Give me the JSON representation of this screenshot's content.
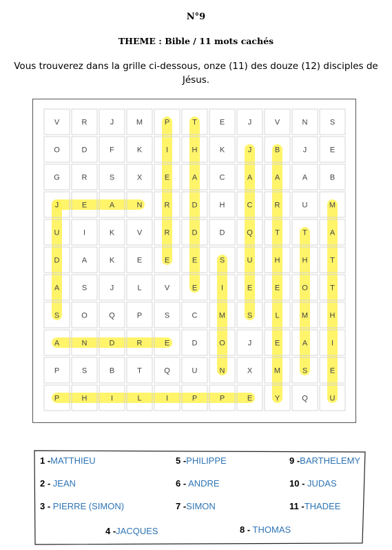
{
  "header": {
    "number": "N°9",
    "theme": "THEME : Bible / 11 mots cachés",
    "intro": "Vous trouverez dans la grille ci-dessous, onze (11) des douze (12) disciples de Jésus."
  },
  "grid": {
    "rows": [
      [
        "V",
        "R",
        "J",
        "M",
        "P",
        "T",
        "E",
        "J",
        "V",
        "N",
        "S"
      ],
      [
        "O",
        "D",
        "F",
        "K",
        "I",
        "H",
        "K",
        "J",
        "B",
        "J",
        "E"
      ],
      [
        "G",
        "R",
        "S",
        "X",
        "E",
        "A",
        "C",
        "A",
        "A",
        "A",
        "B"
      ],
      [
        "J",
        "E",
        "A",
        "N",
        "R",
        "D",
        "H",
        "C",
        "R",
        "U",
        "M"
      ],
      [
        "U",
        "I",
        "K",
        "V",
        "R",
        "D",
        "D",
        "Q",
        "T",
        "T",
        "A"
      ],
      [
        "D",
        "A",
        "K",
        "E",
        "E",
        "E",
        "S",
        "U",
        "H",
        "H",
        "T"
      ],
      [
        "A",
        "S",
        "J",
        "L",
        "V",
        "E",
        "I",
        "E",
        "E",
        "O",
        "T"
      ],
      [
        "S",
        "O",
        "Q",
        "P",
        "S",
        "C",
        "M",
        "S",
        "L",
        "M",
        "H"
      ],
      [
        "A",
        "N",
        "D",
        "R",
        "E",
        "D",
        "O",
        "J",
        "E",
        "A",
        "I"
      ],
      [
        "P",
        "S",
        "B",
        "T",
        "Q",
        "U",
        "N",
        "X",
        "M",
        "S",
        "E"
      ],
      [
        "P",
        "H",
        "I",
        "L",
        "I",
        "P",
        "P",
        "E",
        "Y",
        "Q",
        "U"
      ]
    ],
    "highlight_color": "#fff35a",
    "highlights": [
      {
        "word": "JEAN",
        "from": [
          3,
          0
        ],
        "to": [
          3,
          3
        ]
      },
      {
        "word": "PIERRE",
        "from": [
          0,
          4
        ],
        "to": [
          5,
          4
        ]
      },
      {
        "word": "THADDEE",
        "from": [
          0,
          5
        ],
        "to": [
          6,
          5
        ]
      },
      {
        "word": "JACQUES",
        "from": [
          1,
          7
        ],
        "to": [
          7,
          7
        ]
      },
      {
        "word": "BARTHELEMY",
        "from": [
          1,
          8
        ],
        "to": [
          10,
          8
        ]
      },
      {
        "word": "THOMAS",
        "from": [
          4,
          9
        ],
        "to": [
          9,
          9
        ]
      },
      {
        "word": "MATTHIEU",
        "from": [
          3,
          10
        ],
        "to": [
          10,
          10
        ]
      },
      {
        "word": "JUDAS",
        "from": [
          3,
          0
        ],
        "to": [
          7,
          0
        ]
      },
      {
        "word": "SIMON",
        "from": [
          5,
          6
        ],
        "to": [
          9,
          6
        ]
      },
      {
        "word": "ANDRE",
        "from": [
          8,
          0
        ],
        "to": [
          8,
          4
        ]
      },
      {
        "word": "PHILIPPE",
        "from": [
          10,
          0
        ],
        "to": [
          10,
          7
        ]
      }
    ]
  },
  "answers": [
    {
      "num": "1 -",
      "word": "MATTHIEU"
    },
    {
      "num": "2 -",
      "word": " JEAN"
    },
    {
      "num": "3 -",
      "word": " PIERRE (SIMON)"
    },
    {
      "num": "4 -",
      "word": "JACQUES"
    },
    {
      "num": "5 -",
      "word": "PHILIPPE"
    },
    {
      "num": "6 -",
      "word": " ANDRE"
    },
    {
      "num": "7 -",
      "word": "SIMON"
    },
    {
      "num": "8 -",
      "word": " THOMAS"
    },
    {
      "num": "9 -",
      "word": "BARTHELEMY"
    },
    {
      "num": "10 -",
      "word": " JUDAS"
    },
    {
      "num": "11 -",
      "word": "THADEE"
    }
  ]
}
